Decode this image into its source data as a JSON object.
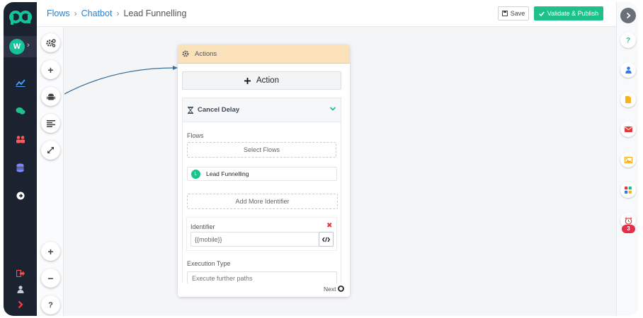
{
  "brand": {
    "logo_icon": "pabbly-logo-icon",
    "accent": "#15c39a"
  },
  "workspace": {
    "avatar_letter": "W"
  },
  "breadcrumb": {
    "items": [
      "Flows",
      "Chatbot"
    ],
    "current": "Lead Funnelling"
  },
  "header": {
    "save_label": "Save",
    "publish_label": "Validate & Publish"
  },
  "nav": {
    "icons": [
      "chart-line-icon",
      "chat-bubbles-icon",
      "users-icon",
      "database-icon",
      "arrow-circle-right-icon"
    ],
    "bottom_icons": [
      "logout-icon",
      "user-icon",
      "chevron-right-icon"
    ]
  },
  "tools": {
    "top": [
      "settings-cogs-icon",
      "add-icon",
      "android-bot-icon",
      "align-left-icon",
      "expand-icon"
    ],
    "bottom": [
      "zoom-in-icon",
      "zoom-out-icon",
      "help-icon"
    ]
  },
  "card": {
    "title": "Actions",
    "add_action_label": "Action",
    "section_title": "Cancel Delay",
    "flows_label": "Flows",
    "select_flows_label": "Select Flows",
    "selected_flow": {
      "badge": "L",
      "name": "Lead Funnelling"
    },
    "add_identifier_label": "Add More Identifier",
    "identifier_label": "Identifier",
    "identifier_value": "{{mobile}}",
    "execution_type_label": "Execution Type",
    "execution_type_value": "Execute further paths",
    "next_label": "Next"
  },
  "rail": {
    "icons": [
      "help-icon",
      "user-icon",
      "document-icon",
      "mail-icon",
      "image-icon",
      "apps-grid-icon",
      "alarm-clock-icon"
    ],
    "alarm_badge": "3"
  }
}
